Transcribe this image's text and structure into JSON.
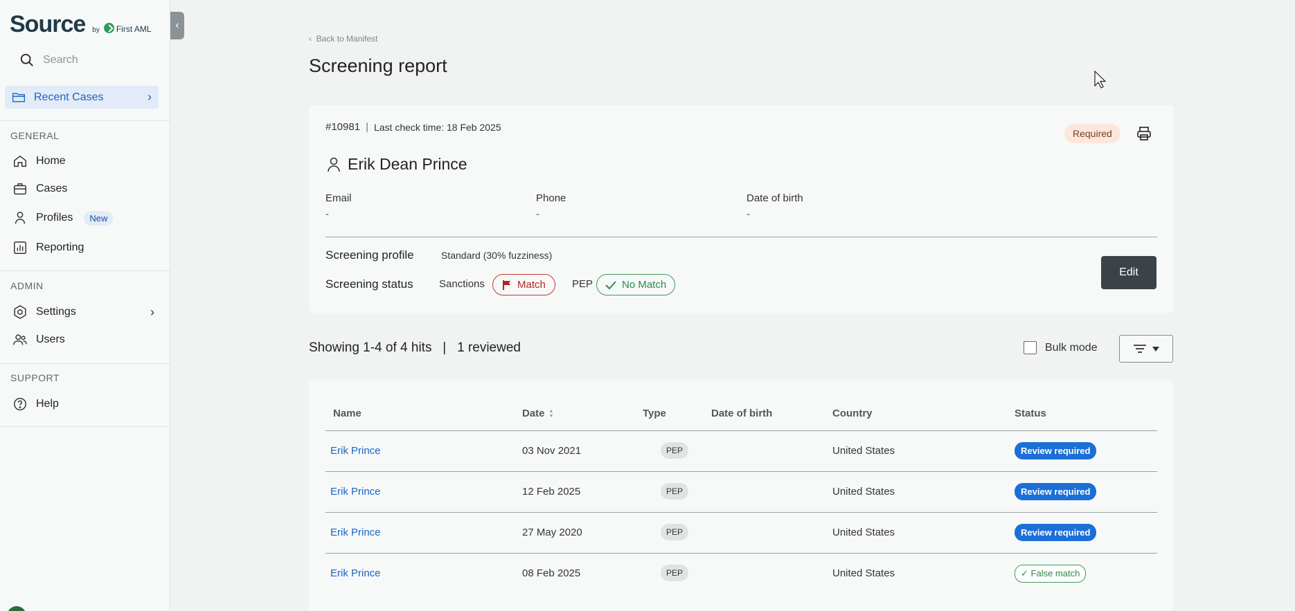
{
  "brand": {
    "name": "Source",
    "by": "by",
    "partner": "First AML"
  },
  "sidebar": {
    "search_placeholder": "Search",
    "recent_cases": "Recent Cases",
    "general_label": "GENERAL",
    "admin_label": "ADMIN",
    "support_label": "SUPPORT",
    "items": {
      "home": "Home",
      "cases": "Cases",
      "profiles": "Profiles",
      "profiles_badge": "New",
      "reporting": "Reporting",
      "settings": "Settings",
      "users": "Users",
      "help": "Help"
    }
  },
  "header": {
    "back_link": "Back to Manifest",
    "title": "Screening report"
  },
  "case": {
    "id": "#10981",
    "separator": "|",
    "last_check": "Last check time: 18 Feb 2025",
    "required_badge": "Required",
    "person_name": "Erik Dean Prince",
    "email_label": "Email",
    "email_value": "-",
    "phone_label": "Phone",
    "phone_value": "-",
    "dob_label": "Date of birth",
    "dob_value": "-",
    "screening_profile_label": "Screening profile",
    "screening_profile_value": "Standard (30% fuzziness)",
    "screening_status_label": "Screening status",
    "sanctions_label": "Sanctions",
    "sanctions_status": "Match",
    "pep_label": "PEP",
    "pep_status": "No Match",
    "edit_button": "Edit"
  },
  "hits": {
    "showing": "Showing 1-4 of 4 hits",
    "separator": "|",
    "reviewed": "1 reviewed",
    "bulk_mode": "Bulk mode"
  },
  "table": {
    "columns": [
      "Name",
      "Date",
      "Type",
      "Date of birth",
      "Country",
      "Status"
    ],
    "rows": [
      {
        "name": "Erik Prince",
        "date": "03 Nov 2021",
        "type": "PEP",
        "dob": "",
        "country": "United States",
        "status": "Review required"
      },
      {
        "name": "Erik Prince",
        "date": "12 Feb 2025",
        "type": "PEP",
        "dob": "",
        "country": "United States",
        "status": "Review required"
      },
      {
        "name": "Erik Prince",
        "date": "27 May 2020",
        "type": "PEP",
        "dob": "",
        "country": "United States",
        "status": "Review required"
      },
      {
        "name": "Erik Prince",
        "date": "08 Feb 2025",
        "type": "PEP",
        "dob": "",
        "country": "United States",
        "status": "False match"
      }
    ]
  },
  "colors": {
    "accent": "#1a64c4",
    "match_red": "#b3261e",
    "nomatch_green": "#2c8a46",
    "review_blue": "#1b6fd6",
    "required_bg": "#fce7dc"
  }
}
